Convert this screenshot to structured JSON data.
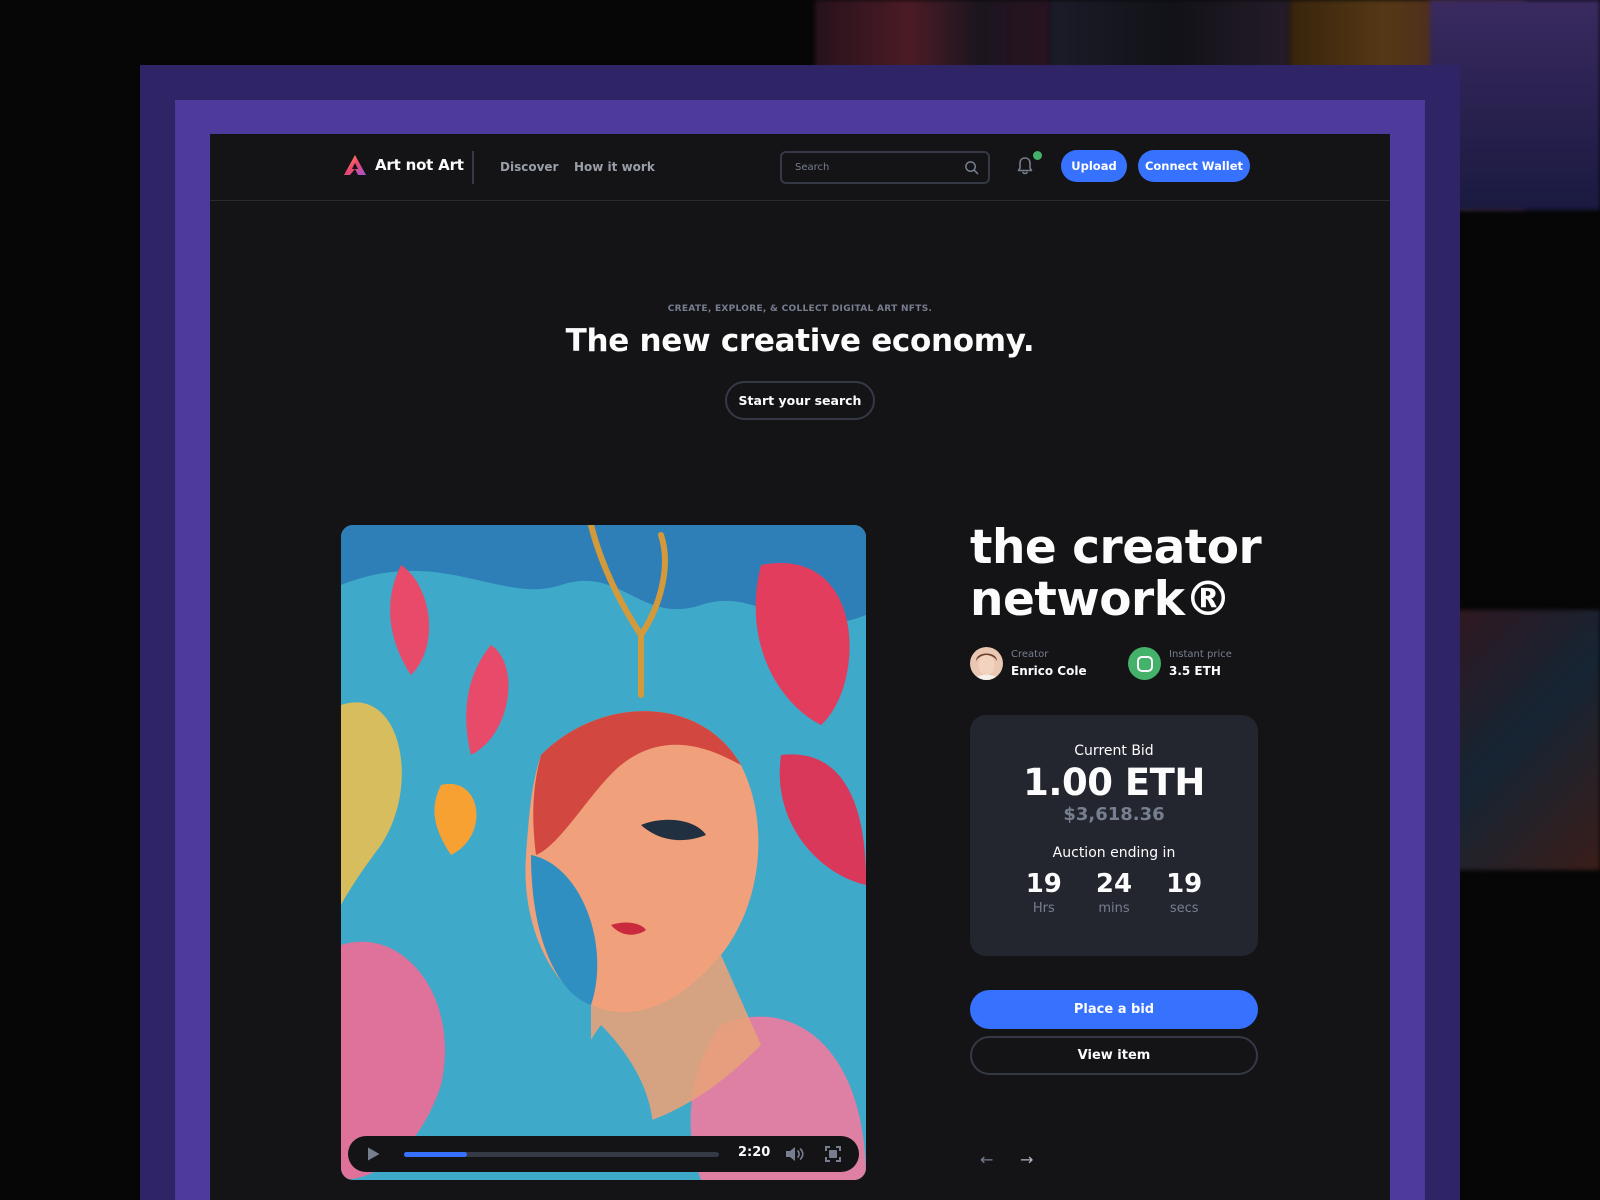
{
  "colors": {
    "accent": "#3772ff",
    "background": "#141416",
    "card": "#23262f",
    "frame_outer": "#2f2466",
    "frame_inner": "#4e3a9d",
    "status_green": "#45b26b"
  },
  "header": {
    "logo_icon": "triangle-logo-icon",
    "brand": "Art not Art",
    "nav": [
      "Discover",
      "How it work"
    ],
    "search": {
      "placeholder": "Search",
      "icon": "search-icon"
    },
    "notification_icon": "bell-icon",
    "upload_label": "Upload",
    "connect_label": "Connect Wallet"
  },
  "hero": {
    "eyebrow": "CREATE, EXPLORE, & COLLECT DIGITAL ART NFTS.",
    "title": "The new creative economy.",
    "cta": "Start your search"
  },
  "player": {
    "time": "2:20",
    "progress": 0.2,
    "play_icon": "play-icon",
    "volume_icon": "volume-icon",
    "fullscreen_icon": "fullscreen-icon"
  },
  "item": {
    "title": "the creator network®",
    "creator_label": "Creator",
    "creator_name": "Enrico Cole",
    "price_label": "Instant price",
    "price_value": "3.5 ETH"
  },
  "bid": {
    "label": "Current Bid",
    "eth": "1.00 ETH",
    "usd": "$3,618.36",
    "auction_label": "Auction ending in",
    "countdown": [
      {
        "value": "19",
        "unit": "Hrs"
      },
      {
        "value": "24",
        "unit": "mins"
      },
      {
        "value": "19",
        "unit": "secs"
      }
    ]
  },
  "actions": {
    "place_bid": "Place a bid",
    "view_item": "View item"
  },
  "pager": {
    "prev": "←",
    "next": "→"
  }
}
